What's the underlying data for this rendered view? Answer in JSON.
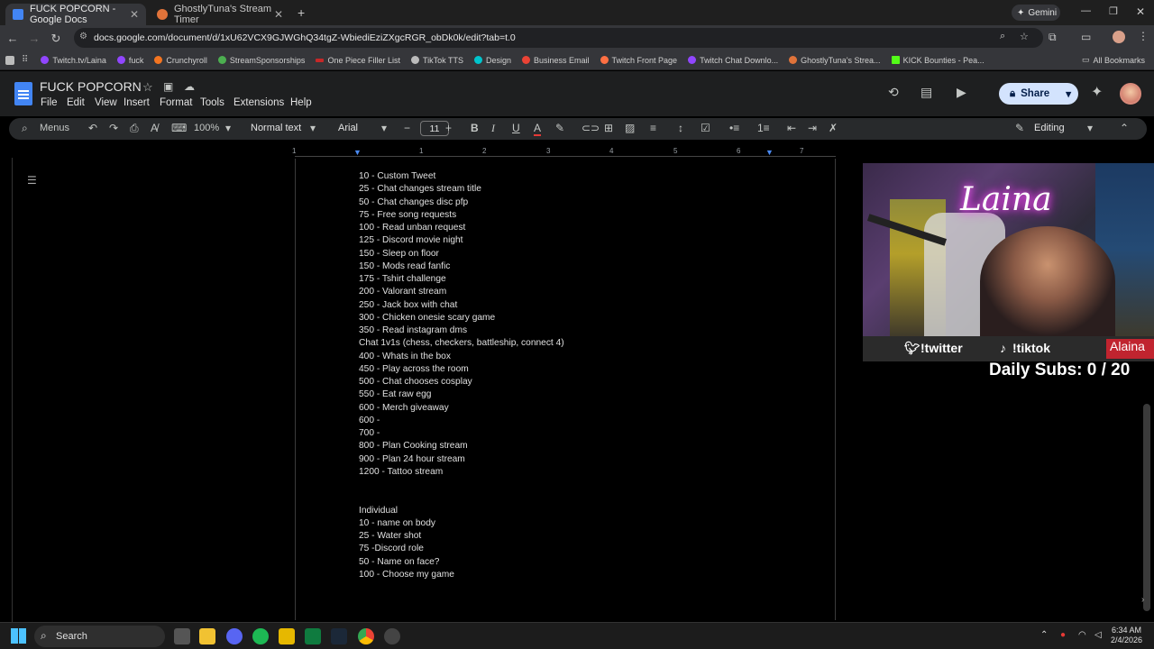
{
  "browser": {
    "tabs": [
      {
        "label": "FUCK POPCORN - Google Docs"
      },
      {
        "label": "GhostlyTuna's Stream Timer"
      }
    ],
    "gemini": "Gemini",
    "url": "docs.google.com/document/d/1xU62VCX9GJWGhQ34tgZ-WbiediEziZXgcRGR_obDk0k/edit?tab=t.0",
    "bookmarks": [
      "Twitch.tv/Laina",
      "fuck",
      "Crunchyroll",
      "StreamSponsorships",
      "One Piece Filler List",
      "TikTok TTS",
      "Design",
      "Business Email",
      "Twitch Front Page",
      "Twitch Chat Downlo...",
      "GhostlyTuna's Strea...",
      "KICK Bounties - Pea..."
    ],
    "all_bookmarks": "All Bookmarks"
  },
  "docs": {
    "title": "FUCK POPCORN",
    "menus": [
      "File",
      "Edit",
      "View",
      "Insert",
      "Format",
      "Tools",
      "Extensions",
      "Help"
    ],
    "share": "Share",
    "toolbar": {
      "menus": "Menus",
      "zoom": "100%",
      "style": "Normal text",
      "font": "Arial",
      "size": "11",
      "mode": "Editing"
    },
    "ruler": [
      "1",
      "1",
      "2",
      "3",
      "4",
      "5",
      "6",
      "7"
    ]
  },
  "document": {
    "lines": [
      "10 - Custom Tweet",
      "25 - Chat changes stream title",
      "50 -  Chat changes disc pfp",
      "75 - Free song requests",
      "100 - Read unban request",
      "125 - Discord movie night",
      "150 - Sleep on floor",
      "150 - Mods read fanfic",
      "175 - Tshirt challenge",
      "200 - Valorant stream",
      "250 - Jack box with chat",
      "300 - Chicken onesie scary game",
      "350 - Read instagram dms",
      "Chat 1v1s (chess, checkers, battleship, connect 4)",
      "400 - Whats in the box",
      "450 - Play across the room",
      "500 - Chat chooses cosplay",
      "550 - Eat raw egg",
      "600 - Merch giveaway",
      "600 -",
      "700 -",
      "800 - Plan Cooking stream",
      "900 - Plan 24 hour stream",
      "1200 - Tattoo stream",
      "",
      "",
      "Individual",
      "10 - name on body",
      "25 - Water shot",
      "75 -Discord role",
      "50 - Name on face?",
      "100 - Choose my game"
    ]
  },
  "stream_overlay": {
    "neon_sign": "Laina",
    "twitter": "!twitter",
    "tiktok": "!tiktok",
    "name_tag": "Alaina",
    "daily_subs": "Daily Subs: 0 / 20"
  },
  "taskbar": {
    "search": "Search",
    "time": "6:34 AM",
    "date": "2/4/2026"
  }
}
